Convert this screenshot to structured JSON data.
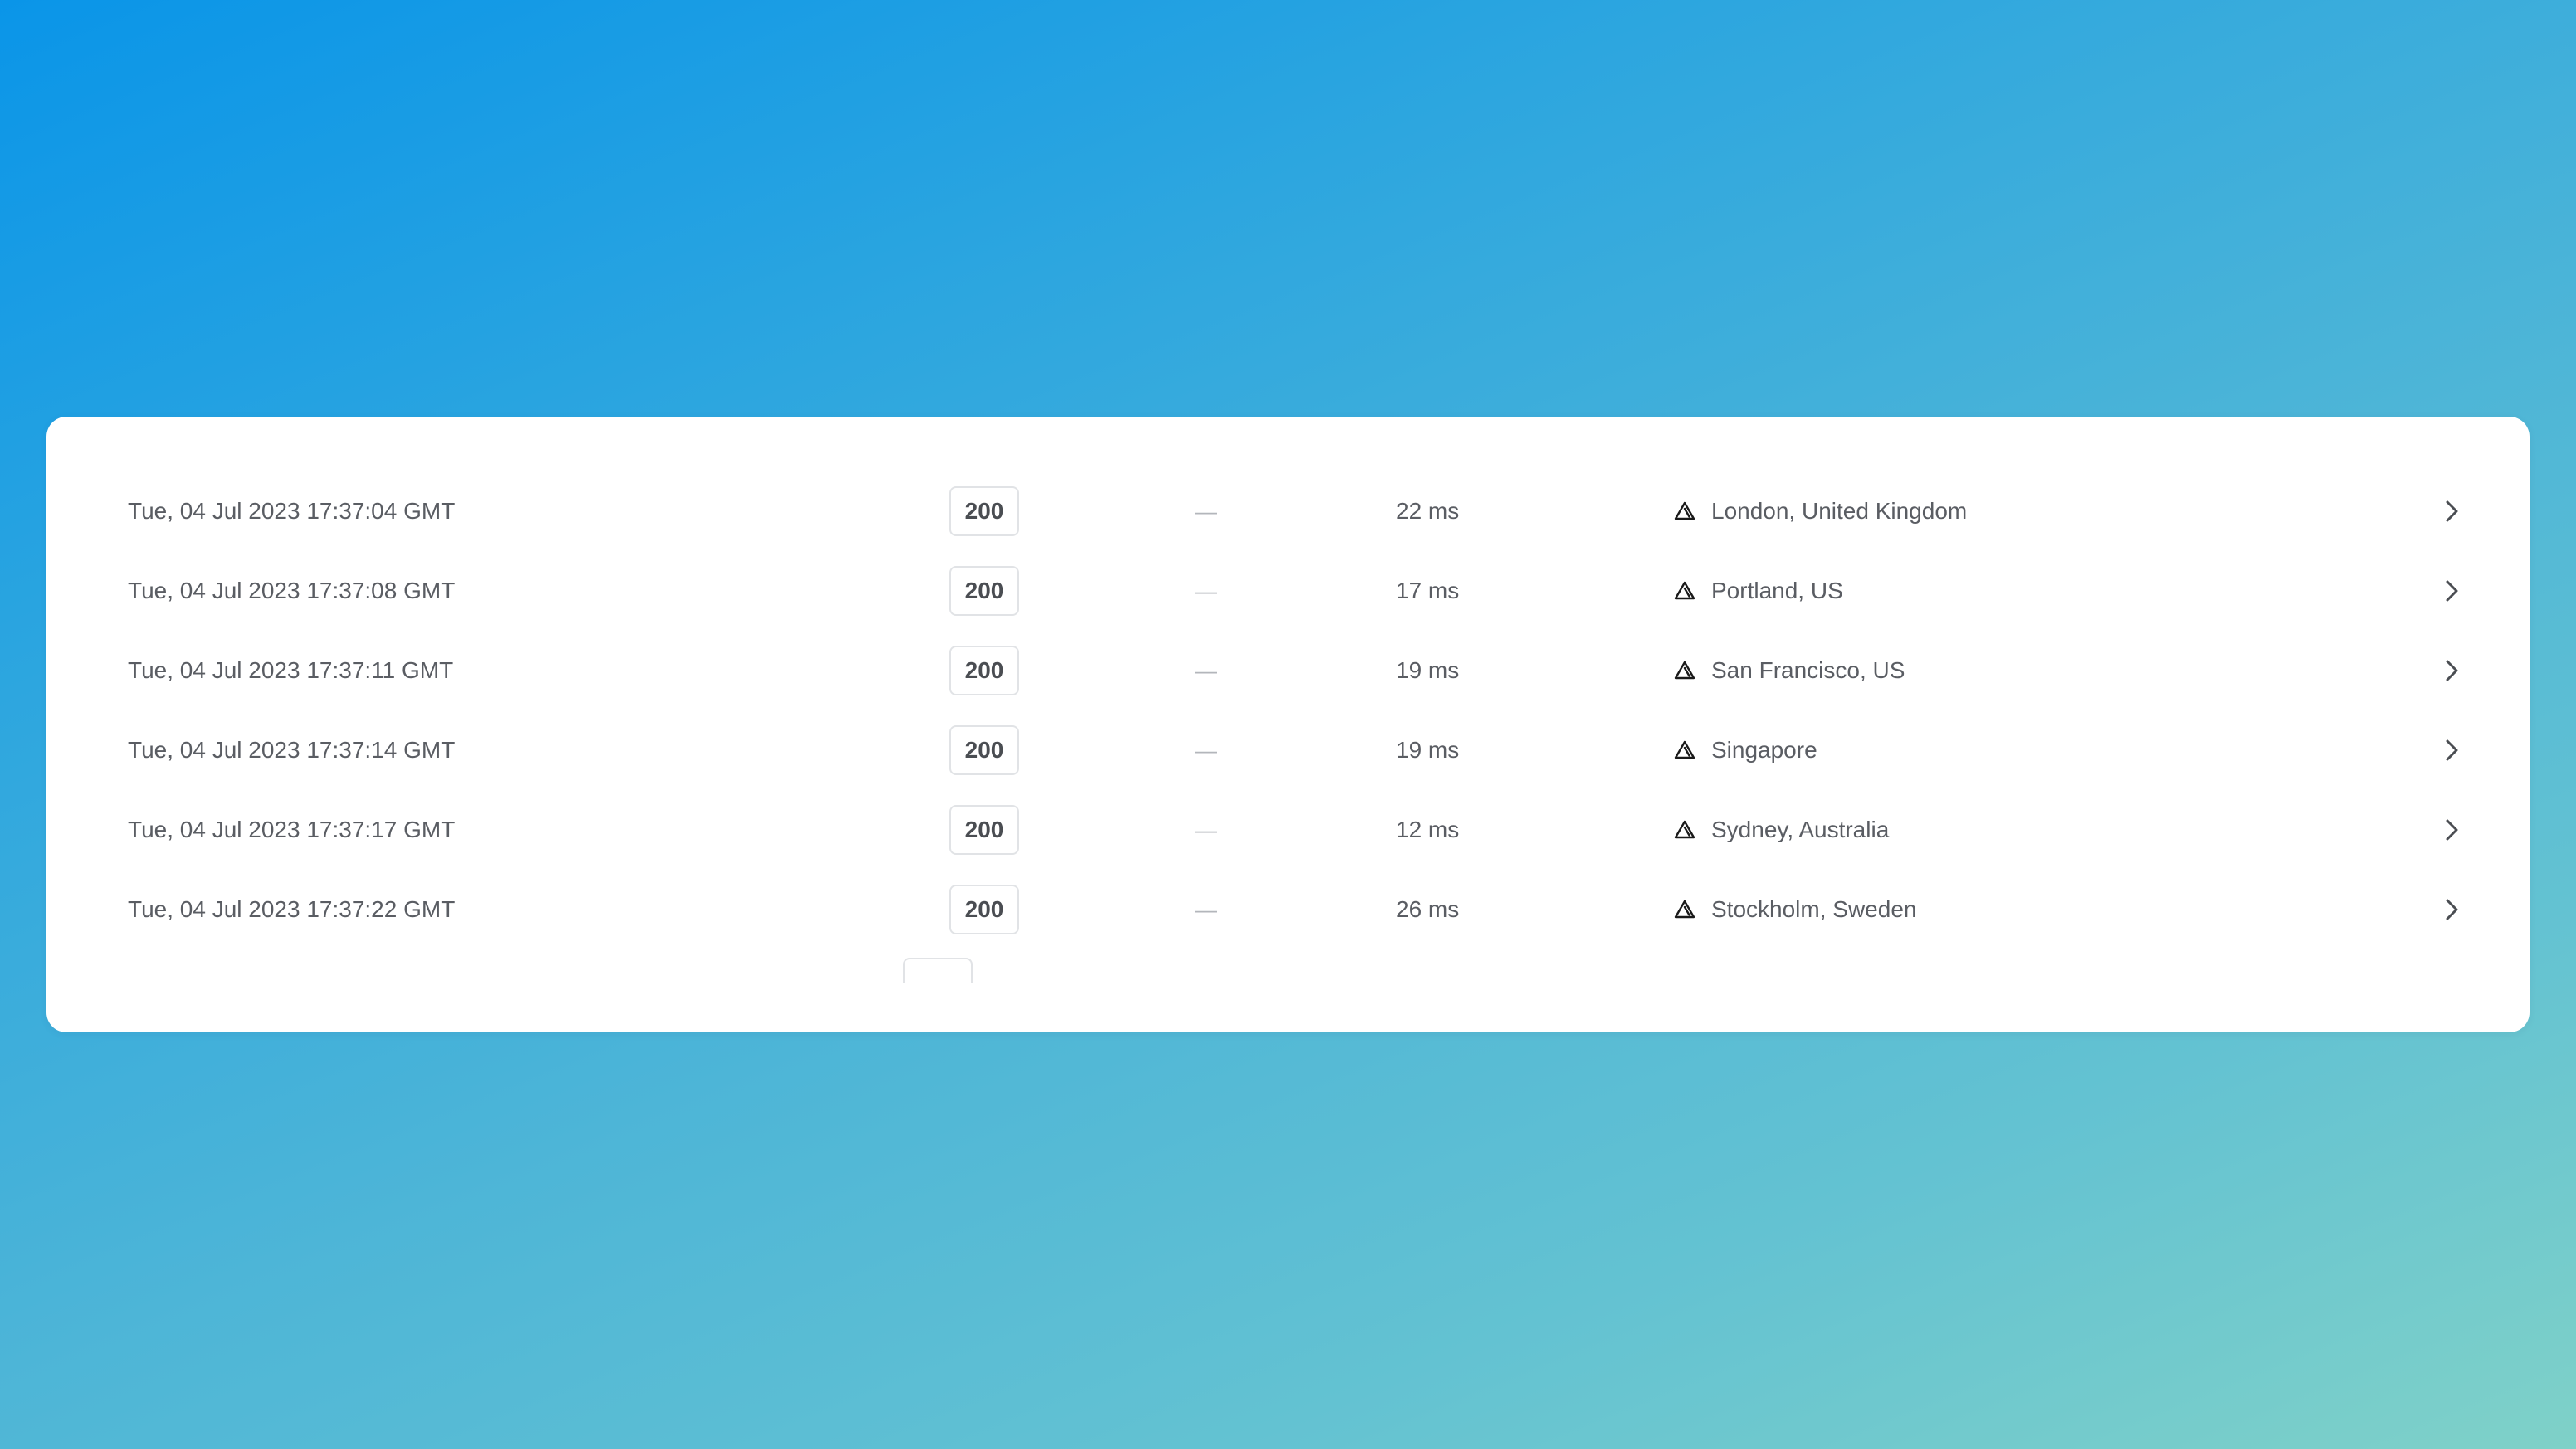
{
  "checks": [
    {
      "time": "Tue, 04 Jul 2023 17:37:04 GMT",
      "status": "200",
      "dash": "—",
      "latency": "22 ms",
      "region": "London, United Kingdom"
    },
    {
      "time": "Tue, 04 Jul 2023 17:37:08 GMT",
      "status": "200",
      "dash": "—",
      "latency": "17 ms",
      "region": "Portland, US"
    },
    {
      "time": "Tue, 04 Jul 2023 17:37:11 GMT",
      "status": "200",
      "dash": "—",
      "latency": "19 ms",
      "region": "San Francisco, US"
    },
    {
      "time": "Tue, 04 Jul 2023 17:37:14 GMT",
      "status": "200",
      "dash": "—",
      "latency": "19 ms",
      "region": "Singapore"
    },
    {
      "time": "Tue, 04 Jul 2023 17:37:17 GMT",
      "status": "200",
      "dash": "—",
      "latency": "12 ms",
      "region": "Sydney, Australia"
    },
    {
      "time": "Tue, 04 Jul 2023 17:37:22 GMT",
      "status": "200",
      "dash": "—",
      "latency": "26 ms",
      "region": "Stockholm, Sweden"
    }
  ],
  "icons": {
    "region": "triangle-provider-icon",
    "row_action": "chevron-right-icon"
  },
  "colors": {
    "background_start": "#0a95e8",
    "background_end": "#7fd1c8",
    "card": "#ffffff",
    "text": "#5a5d63",
    "badge_border": "#e1e3e6"
  }
}
